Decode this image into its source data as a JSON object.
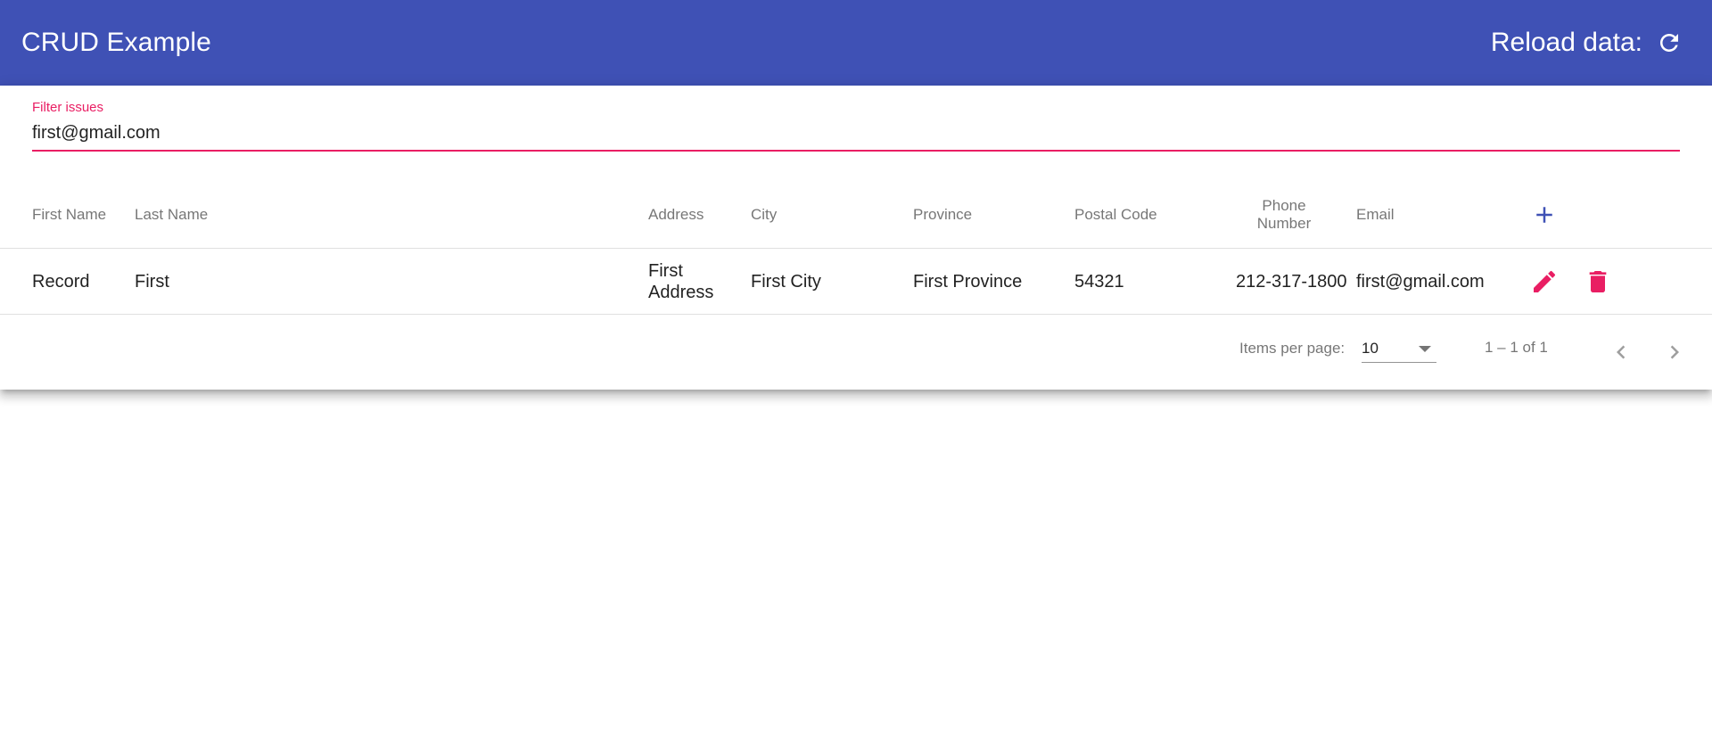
{
  "app": {
    "title": "CRUD Example",
    "reload_label": "Reload data:",
    "reload_icon": "refresh-icon"
  },
  "filter": {
    "label": "Filter issues",
    "value": "first@gmail.com"
  },
  "table": {
    "columns": [
      "First Name",
      "Last Name",
      "Address",
      "City",
      "Province",
      "Postal Code",
      "Phone Number",
      "Email"
    ],
    "add_icon": "plus-icon",
    "rows": [
      {
        "first_name": "Record",
        "last_name": "First",
        "address": "First Address",
        "city": "First City",
        "province": "First Province",
        "postal_code": "54321",
        "phone": "212-317-1800",
        "email": "first@gmail.com",
        "edit_icon": "pencil-icon",
        "delete_icon": "trash-icon"
      }
    ]
  },
  "paginator": {
    "items_per_page_label": "Items per page:",
    "page_size": "10",
    "range_label": "1 – 1 of 1",
    "prev_icon": "chevron-left-icon",
    "next_icon": "chevron-right-icon"
  },
  "colors": {
    "primary": "#3f51b5",
    "accent": "#e91e63"
  }
}
